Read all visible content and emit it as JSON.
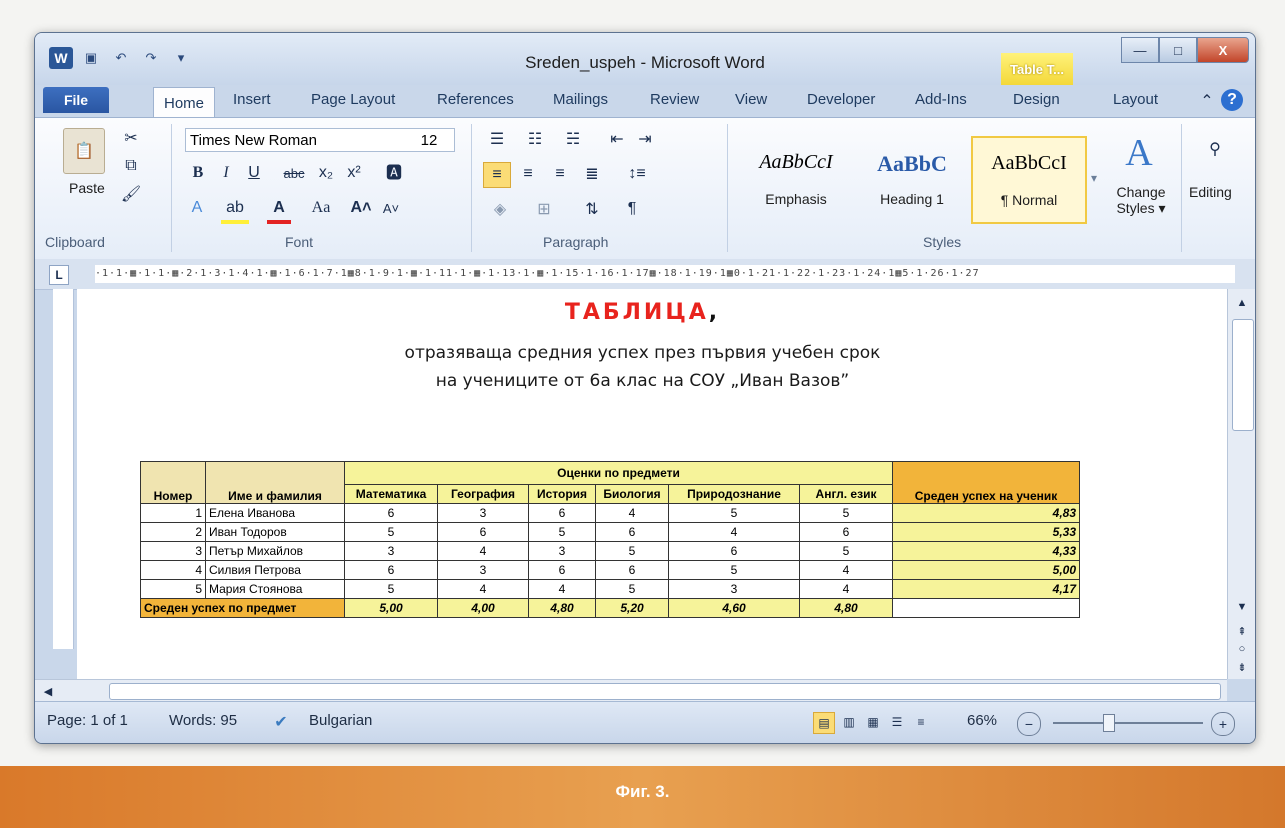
{
  "window": {
    "title": "Sreden_uspeh - Microsoft Word",
    "context_tab": "Table T...",
    "min": "—",
    "max": "□",
    "close": "X"
  },
  "tabs": [
    "File",
    "Home",
    "Insert",
    "Page Layout",
    "References",
    "Mailings",
    "Review",
    "View",
    "Developer",
    "Add-Ins",
    "Design",
    "Layout"
  ],
  "ribbon": {
    "paste": "Paste",
    "clipboard_label": "Clipboard",
    "font_name": "Times New Roman",
    "font_size": "12",
    "font_label": "Font",
    "paragraph_label": "Paragraph",
    "styles_label": "Styles",
    "styles": [
      {
        "sample": "AaBbCcI",
        "name": "Emphasis"
      },
      {
        "sample": "AaBbC",
        "name": "Heading 1"
      },
      {
        "sample": "AaBbCcI",
        "name": "¶ Normal"
      }
    ],
    "change_styles": "Change Styles ▾",
    "editing": "Editing"
  },
  "document": {
    "heading": "ТАБЛИЦА",
    "heading_punct": ",",
    "subtitle1": "отразяваща средния успех през първия учебен срок",
    "subtitle2": "на учениците от 6а клас на СОУ „Иван Вазов”",
    "table": {
      "group_header": "Оценки по предмети",
      "col_num": "Номер",
      "col_name": "Име и фамилия",
      "subjects": [
        "Математика",
        "География",
        "История",
        "Биология",
        "Природознание",
        "Англ. език"
      ],
      "col_avg": "Среден успех на ученик",
      "rows": [
        {
          "num": "1",
          "name": "Елена Иванова",
          "grades": [
            "6",
            "3",
            "6",
            "4",
            "5",
            "5"
          ],
          "avg": "4,83"
        },
        {
          "num": "2",
          "name": "Иван Тодоров",
          "grades": [
            "5",
            "6",
            "5",
            "6",
            "4",
            "6"
          ],
          "avg": "5,33"
        },
        {
          "num": "3",
          "name": "Петър Михайлов",
          "grades": [
            "3",
            "4",
            "3",
            "5",
            "6",
            "5"
          ],
          "avg": "4,33"
        },
        {
          "num": "4",
          "name": "Силвия Петрова",
          "grades": [
            "6",
            "3",
            "6",
            "6",
            "5",
            "4"
          ],
          "avg": "5,00"
        },
        {
          "num": "5",
          "name": "Мария Стоянова",
          "grades": [
            "5",
            "4",
            "4",
            "5",
            "3",
            "4"
          ],
          "avg": "4,17"
        }
      ],
      "footer_label": "Среден успех по предмет",
      "footer_values": [
        "5,00",
        "4,00",
        "4,80",
        "5,20",
        "4,60",
        "4,80"
      ]
    }
  },
  "status": {
    "page": "Page: 1 of 1",
    "words": "Words: 95",
    "language": "Bulgarian",
    "zoom": "66%"
  },
  "caption": "Фиг. 3."
}
